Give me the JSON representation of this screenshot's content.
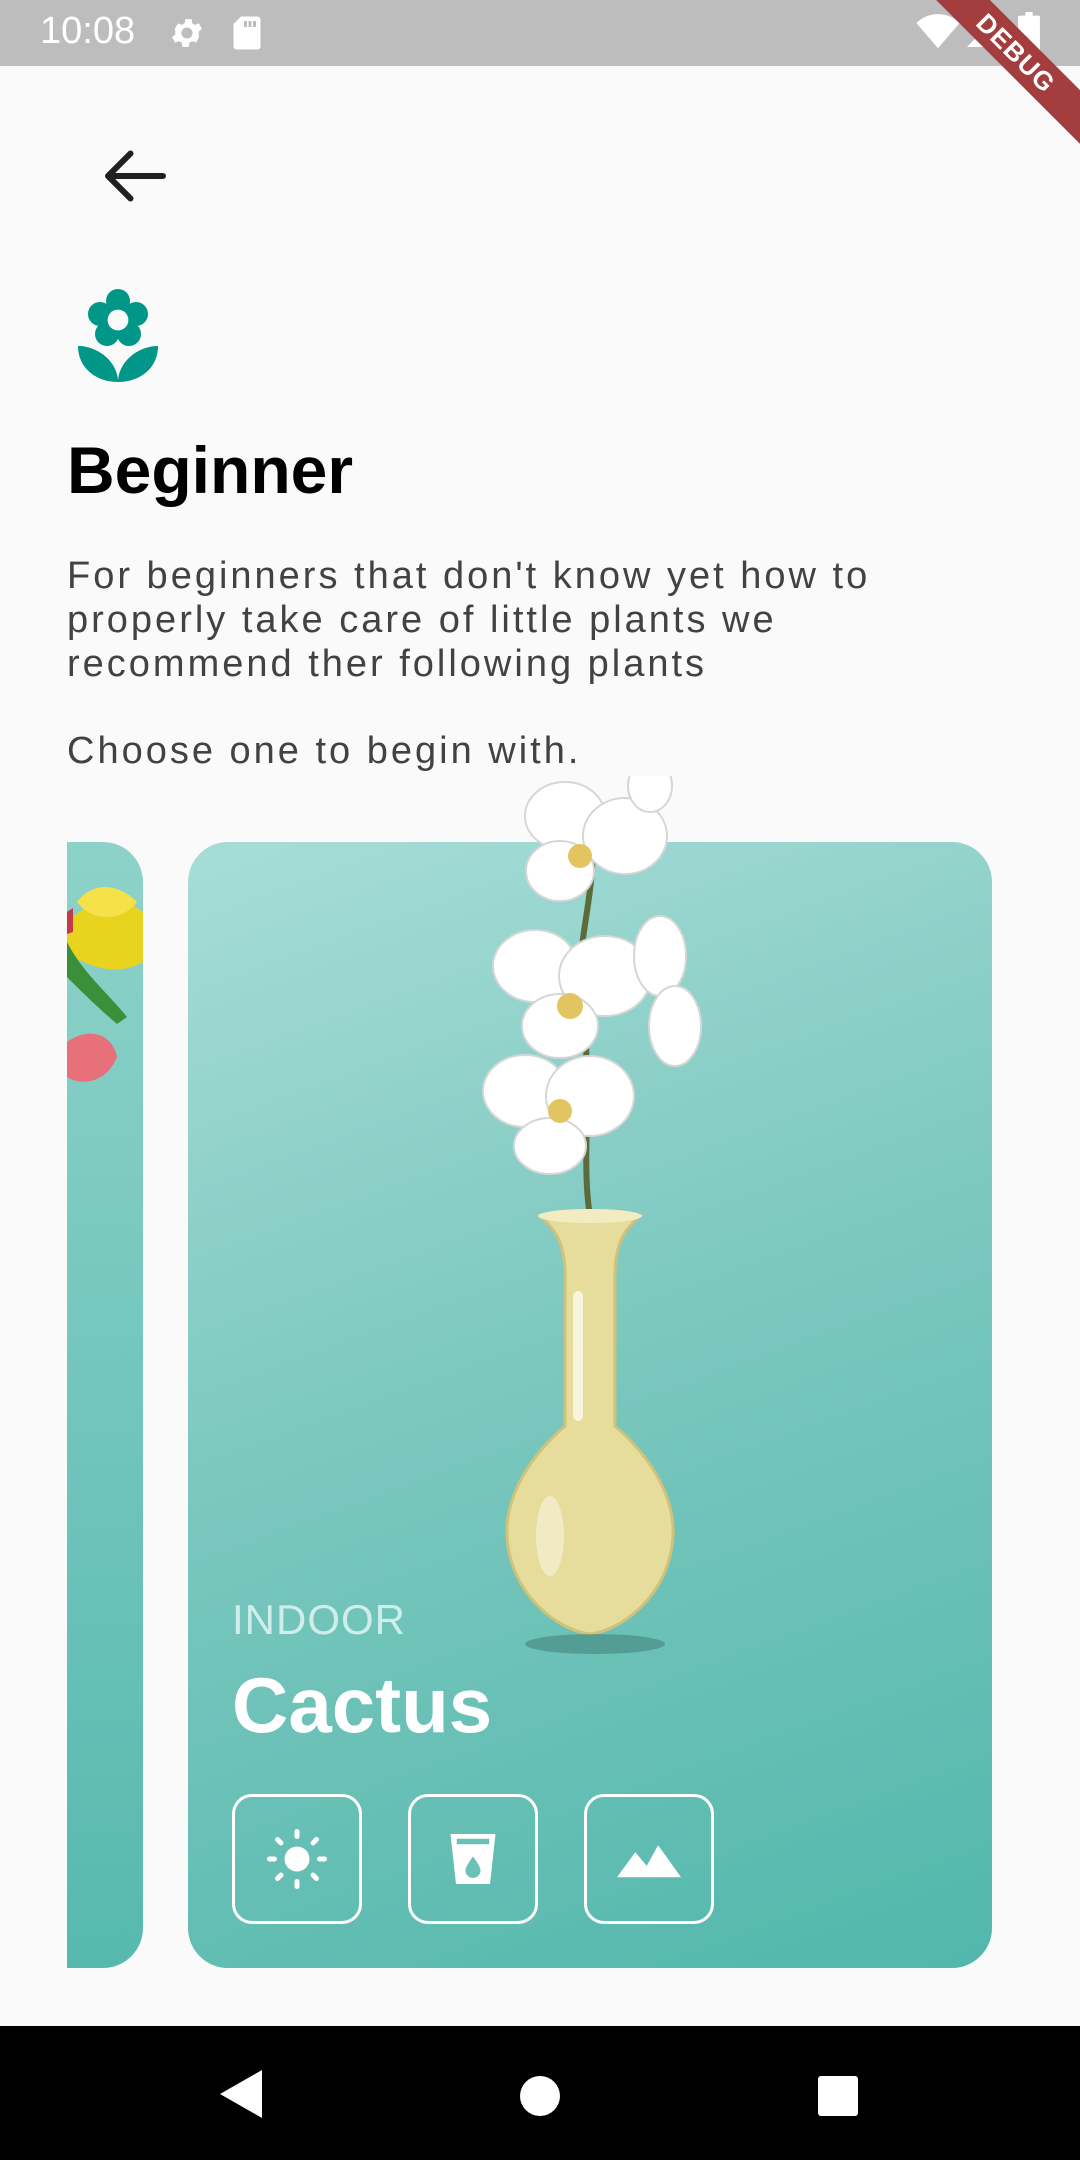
{
  "status_bar": {
    "time": "10:08",
    "debug_banner": "DEBUG",
    "icons": [
      "gear-icon",
      "sd-card-icon",
      "wifi-icon",
      "signal-icon",
      "battery-icon"
    ]
  },
  "header": {
    "back_icon": "arrow-back-icon",
    "logo_icon": "flower-icon",
    "title": "Beginner",
    "description": "For beginners that don't know yet how to\nproperly take care of little plants we\nrecommend ther following plants",
    "prompt": "Choose one to begin with."
  },
  "carousel": {
    "selected_card": {
      "category": "INDOOR",
      "name": "Cactus",
      "attributes": [
        "sun-icon",
        "water-glass-icon",
        "terrain-icon"
      ]
    }
  },
  "colors": {
    "accent": "#009688",
    "card_top": "#a7ddd7",
    "card_bottom": "#52b7ab",
    "debug_ribbon": "#a43d3d"
  },
  "nav_bar": {
    "icons": [
      "nav-back-icon",
      "nav-home-icon",
      "nav-recents-icon"
    ]
  }
}
